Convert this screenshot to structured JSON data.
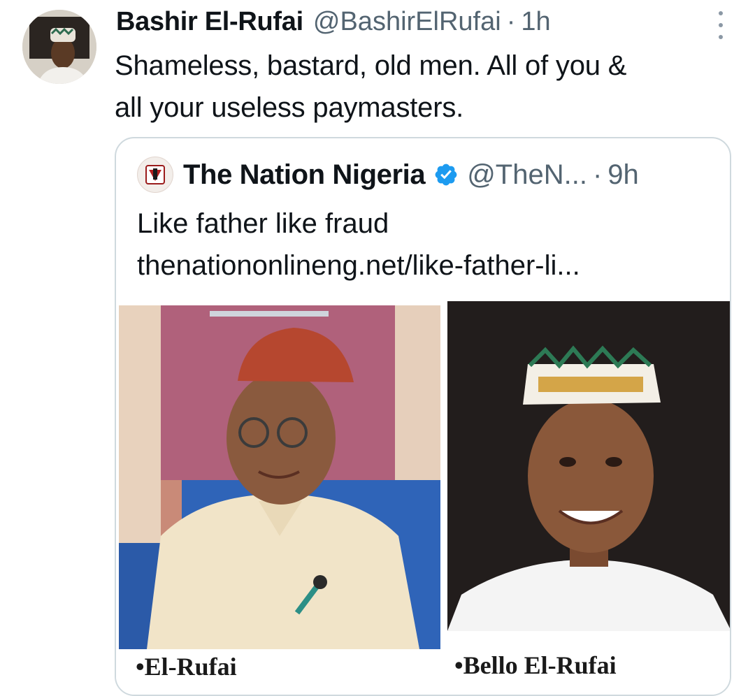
{
  "tweet": {
    "author_name": "Bashir El-Rufai",
    "author_handle": "@BashirElRufai",
    "separator": "·",
    "time": "1h",
    "text_line1": "Shameless, bastard, old men. All of you &",
    "text_line2": "all your useless paymasters."
  },
  "quoted": {
    "author_name": "The Nation Nigeria",
    "author_handle": "@TheN...",
    "separator": "·",
    "time": "9h",
    "text": "Like father like fraud",
    "link": "thenationonlineng.net/like-father-li..."
  },
  "media": {
    "left_caption": "•El-Rufai",
    "right_caption": "•Bello El-Rufai"
  },
  "icons": {
    "more": "more-vertical-icon",
    "verified": "verified-badge-icon"
  },
  "colors": {
    "text": "#0f1419",
    "secondary": "#536471",
    "verified": "#1d9bf0",
    "border": "#cfd9de"
  }
}
